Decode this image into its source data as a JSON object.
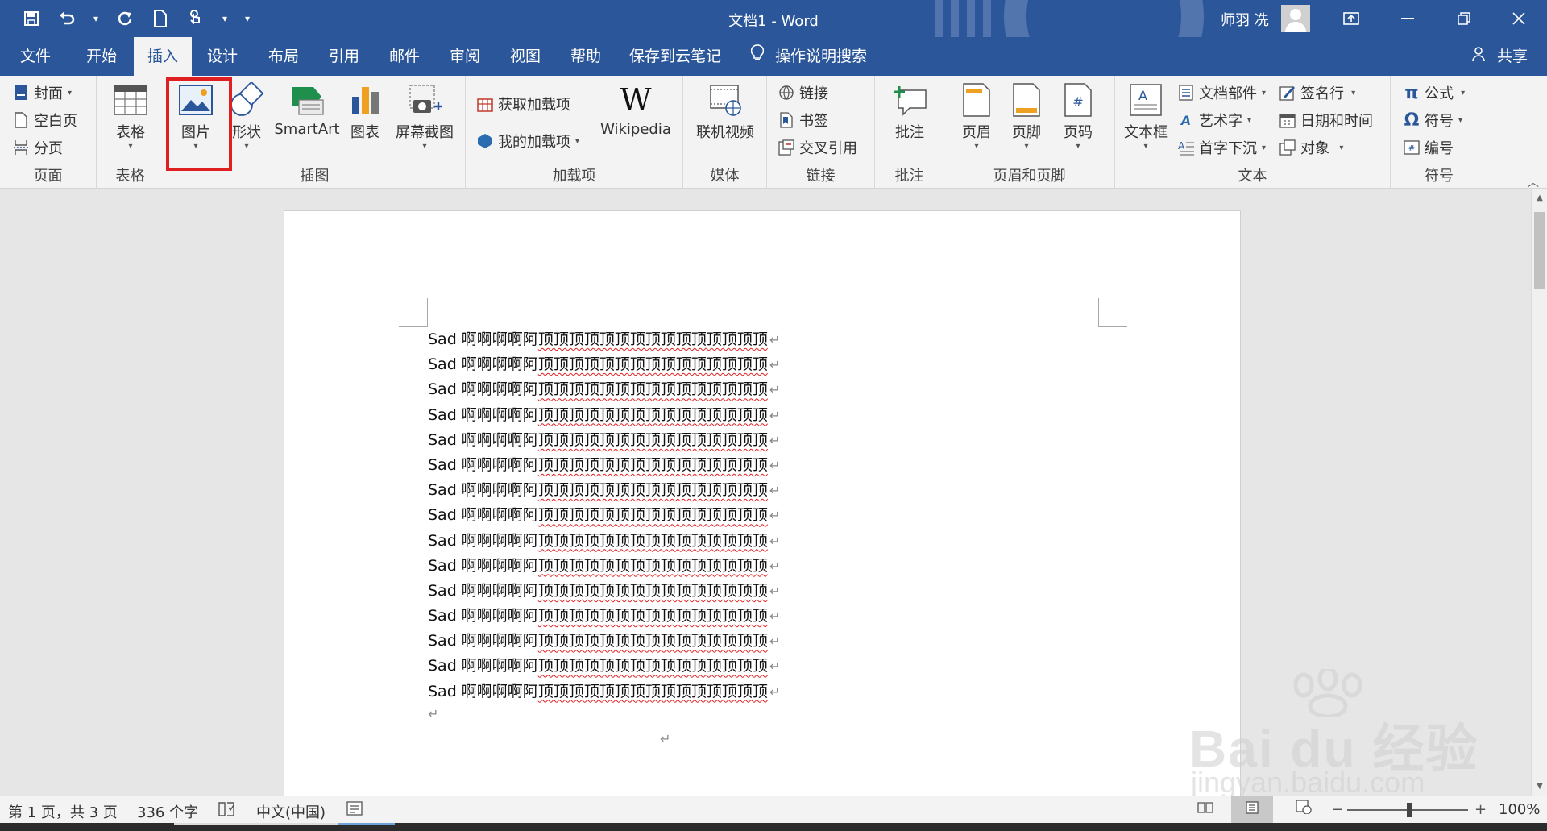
{
  "titlebar": {
    "document_title": "文档1  -  Word",
    "user_name": "师羽 冼",
    "qat_icons": [
      "save-icon",
      "undo-icon",
      "redo-icon",
      "new-document-icon",
      "touch-mode-icon",
      "customize-qat-icon"
    ],
    "window_buttons": [
      "ribbon-display-options-icon",
      "minimize-icon",
      "restore-icon",
      "close-icon"
    ]
  },
  "tabs": {
    "items": [
      "文件",
      "开始",
      "插入",
      "设计",
      "布局",
      "引用",
      "邮件",
      "审阅",
      "视图",
      "帮助",
      "保存到云笔记"
    ],
    "active": "插入",
    "search": "操作说明搜索",
    "share": "共享"
  },
  "ribbon": {
    "pages": {
      "label": "页面",
      "cover": "封面",
      "blank_page": "空白页",
      "page_break": "分页"
    },
    "tables": {
      "label": "表格",
      "table": "表格"
    },
    "illustrations": {
      "label": "插图",
      "picture": "图片",
      "shapes": "形状",
      "smartart": "SmartArt",
      "chart": "图表",
      "screenshot": "屏幕截图"
    },
    "addins": {
      "label": "加载项",
      "get_addins": "获取加载项",
      "my_addins": "我的加载项",
      "wikipedia": "Wikipedia"
    },
    "media": {
      "label": "媒体",
      "online_video": "联机视频"
    },
    "links": {
      "label": "链接",
      "link": "链接",
      "bookmark": "书签",
      "cross_ref": "交叉引用"
    },
    "comments": {
      "label": "批注",
      "comment": "批注"
    },
    "header_footer": {
      "label": "页眉和页脚",
      "header": "页眉",
      "footer": "页脚",
      "page_number": "页码"
    },
    "text": {
      "label": "文本",
      "textbox": "文本框",
      "quick_parts": "文档部件",
      "wordart": "艺术字",
      "dropcap": "首字下沉",
      "signature": "签名行",
      "datetime": "日期和时间",
      "object": "对象"
    },
    "symbols": {
      "label": "符号",
      "equation": "公式",
      "symbol": "符号",
      "number": "编号"
    },
    "highlighted_button": "图片"
  },
  "document": {
    "lines": [
      {
        "a": "Sad 啊啊啊啊阿",
        "b": "顶顶顶顶顶顶顶顶顶顶顶顶顶顶顶"
      },
      {
        "a": "Sad 啊啊啊啊阿",
        "b": "顶顶顶顶顶顶顶顶顶顶顶顶顶顶顶"
      },
      {
        "a": "Sad 啊啊啊啊阿",
        "b": "顶顶顶顶顶顶顶顶顶顶顶顶顶顶顶"
      },
      {
        "a": "Sad 啊啊啊啊阿",
        "b": "顶顶顶顶顶顶顶顶顶顶顶顶顶顶顶"
      },
      {
        "a": "Sad 啊啊啊啊阿",
        "b": "顶顶顶顶顶顶顶顶顶顶顶顶顶顶顶"
      },
      {
        "a": "Sad 啊啊啊啊阿",
        "b": "顶顶顶顶顶顶顶顶顶顶顶顶顶顶顶"
      },
      {
        "a": "Sad 啊啊啊啊阿",
        "b": "顶顶顶顶顶顶顶顶顶顶顶顶顶顶顶"
      },
      {
        "a": "Sad 啊啊啊啊阿",
        "b": "顶顶顶顶顶顶顶顶顶顶顶顶顶顶顶"
      },
      {
        "a": "Sad 啊啊啊啊阿",
        "b": "顶顶顶顶顶顶顶顶顶顶顶顶顶顶顶"
      },
      {
        "a": "Sad 啊啊啊啊阿",
        "b": "顶顶顶顶顶顶顶顶顶顶顶顶顶顶顶"
      },
      {
        "a": "Sad 啊啊啊啊阿",
        "b": "顶顶顶顶顶顶顶顶顶顶顶顶顶顶顶"
      },
      {
        "a": "Sad 啊啊啊啊阿",
        "b": "顶顶顶顶顶顶顶顶顶顶顶顶顶顶顶"
      },
      {
        "a": "Sad 啊啊啊啊阿",
        "b": "顶顶顶顶顶顶顶顶顶顶顶顶顶顶顶"
      },
      {
        "a": "Sad 啊啊啊啊阿",
        "b": "顶顶顶顶顶顶顶顶顶顶顶顶顶顶顶"
      },
      {
        "a": "Sad 啊啊啊啊阿",
        "b": "顶顶顶顶顶顶顶顶顶顶顶顶顶顶顶"
      }
    ],
    "paragraph_mark": "↵"
  },
  "watermark": {
    "brand": "Bai du 经验",
    "url": "jingyan.baidu.com"
  },
  "status": {
    "page_info": "第 1 页，共 3 页",
    "word_count": "336 个字",
    "language": "中文(中国)",
    "zoom": "100%",
    "zoom_minus": "−",
    "zoom_plus": "+"
  },
  "colors": {
    "word_blue": "#2b579a",
    "highlight_red": "#e02020",
    "ribbon_bg": "#f3f3f3"
  }
}
